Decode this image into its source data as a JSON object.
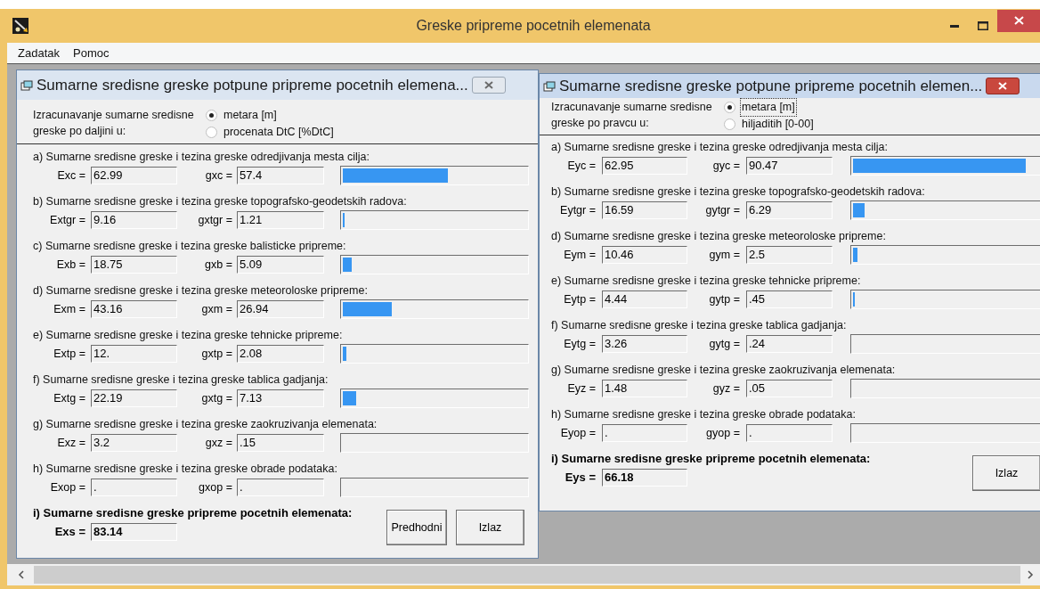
{
  "window": {
    "title": "Greske pripreme pocetnih elemenata"
  },
  "menu": [
    "Zadatak",
    "Pomoc"
  ],
  "dialogs": [
    {
      "title": "Sumarne sredisne greske potpune pripreme pocetnih elemena...",
      "active": false,
      "unit_label": "Izracunavanje sumarne sredisne greske po daljini u:",
      "options": [
        {
          "label": "metara [m]",
          "selected": true,
          "focused": false
        },
        {
          "label": "procenata DtC [%DtC]",
          "selected": false,
          "focused": false
        }
      ],
      "sections": [
        {
          "heading": "a) Sumarne sredisne greske i tezina greske odredjivanja mesta cilja:",
          "e_label": "Exc =",
          "e_value": "62.99",
          "g_label": "gxc =",
          "g_value": "57.4",
          "level": 0.574
        },
        {
          "heading": "b) Sumarne sredisne greske i tezina greske topografsko-geodetskih radova:",
          "e_label": "Extgr =",
          "e_value": "9.16",
          "g_label": "gxtgr =",
          "g_value": "1.21",
          "level": 0.0121
        },
        {
          "heading": "c) Sumarne sredisne greske i tezina greske balisticke pripreme:",
          "e_label": "Exb =",
          "e_value": "18.75",
          "g_label": "gxb =",
          "g_value": "5.09",
          "level": 0.0509
        },
        {
          "heading": "d) Sumarne sredisne greske i tezina greske meteoroloske pripreme:",
          "e_label": "Exm =",
          "e_value": "43.16",
          "g_label": "gxm =",
          "g_value": "26.94",
          "level": 0.2694
        },
        {
          "heading": "e) Sumarne sredisne greske i tezina greske tehnicke pripreme:",
          "e_label": "Extp =",
          "e_value": "12.",
          "g_label": "gxtp =",
          "g_value": "2.08",
          "level": 0.0208
        },
        {
          "heading": "f) Sumarne sredisne greske i tezina greske tablica gadjanja:",
          "e_label": "Extg =",
          "e_value": "22.19",
          "g_label": "gxtg =",
          "g_value": "7.13",
          "level": 0.0713
        },
        {
          "heading": "g) Sumarne sredisne greske i tezina greske zaokruzivanja elemenata:",
          "e_label": "Exz =",
          "e_value": "3.2",
          "g_label": "gxz =",
          "g_value": ".15",
          "level": 0
        },
        {
          "heading": "h) Sumarne sredisne greske i tezina greske obrade podataka:",
          "e_label": "Exop =",
          "e_value": ".",
          "g_label": "gxop =",
          "g_value": ".",
          "level": 0
        }
      ],
      "total": {
        "heading": "i) Sumarne sredisne greske pripreme pocetnih elemenata:",
        "label": "Exs =",
        "value": "83.14"
      },
      "buttons": [
        "Predhodni",
        "Izlaz"
      ]
    },
    {
      "title": "Sumarne sredisne greske potpune pripreme pocetnih elemen...",
      "active": true,
      "unit_label": "Izracunavanje sumarne sredisne greske po pravcu u:",
      "options": [
        {
          "label": "metara [m]",
          "selected": true,
          "focused": true
        },
        {
          "label": "hiljaditih [0-00]",
          "selected": false,
          "focused": false
        }
      ],
      "sections": [
        {
          "heading": "a) Sumarne sredisne greske i tezina greske odredjivanja mesta cilja:",
          "e_label": "Eyc =",
          "e_value": "62.95",
          "g_label": "gyc =",
          "g_value": "90.47",
          "level": 0.9047
        },
        {
          "heading": "b) Sumarne sredisne greske i tezina greske topografsko-geodetskih radova:",
          "e_label": "Eytgr =",
          "e_value": "16.59",
          "g_label": "gytgr =",
          "g_value": "6.29",
          "level": 0.0629
        },
        {
          "heading": "d) Sumarne sredisne greske i tezina greske meteoroloske pripreme:",
          "e_label": "Eym =",
          "e_value": "10.46",
          "g_label": "gym =",
          "g_value": "2.5",
          "level": 0.025
        },
        {
          "heading": "e) Sumarne sredisne greske i tezina greske tehnicke pripreme:",
          "e_label": "Eytp =",
          "e_value": "4.44",
          "g_label": "gytp =",
          "g_value": ".45",
          "level": 0.0045
        },
        {
          "heading": "f) Sumarne sredisne greske i tezina greske tablica gadjanja:",
          "e_label": "Eytg =",
          "e_value": "3.26",
          "g_label": "gytg =",
          "g_value": ".24",
          "level": 0
        },
        {
          "heading": "g) Sumarne sredisne greske i tezina greske zaokruzivanja elemenata:",
          "e_label": "Eyz =",
          "e_value": "1.48",
          "g_label": "gyz =",
          "g_value": ".05",
          "level": 0
        },
        {
          "heading": "h) Sumarne sredisne greske i tezina greske obrade podataka:",
          "e_label": "Eyop =",
          "e_value": ".",
          "g_label": "gyop =",
          "g_value": ".",
          "level": 0
        }
      ],
      "total": {
        "heading": "i) Sumarne sredisne greske pripreme pocetnih elemenata:",
        "label": "Eys =",
        "value": "66.18"
      },
      "buttons": [
        "Izlaz"
      ]
    }
  ]
}
